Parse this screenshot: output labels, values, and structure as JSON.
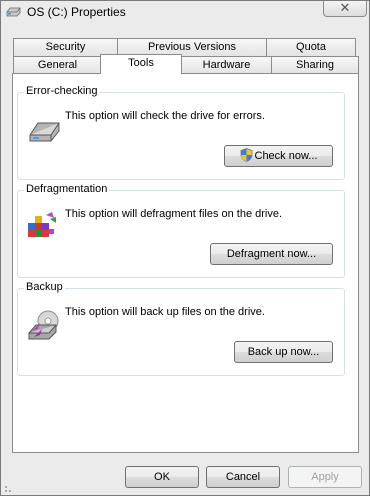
{
  "window": {
    "title": "OS (C:) Properties",
    "close_glyph": "✕"
  },
  "tabs_back": [
    "Security",
    "Previous Versions",
    "Quota"
  ],
  "tabs_front": [
    "General",
    "Tools",
    "Hardware",
    "Sharing"
  ],
  "active_tab": "Tools",
  "groups": [
    {
      "title": "Error-checking",
      "description": "This option will check the drive for errors.",
      "button": "Check now...",
      "icon": "disk-check-icon"
    },
    {
      "title": "Defragmentation",
      "description": "This option will defragment files on the drive.",
      "button": "Defragment now...",
      "icon": "defragment-icon"
    },
    {
      "title": "Backup",
      "description": "This option will back up files on the drive.",
      "button": "Back up now...",
      "icon": "backup-icon"
    }
  ],
  "footer": {
    "ok": "OK",
    "cancel": "Cancel",
    "apply": "Apply"
  }
}
